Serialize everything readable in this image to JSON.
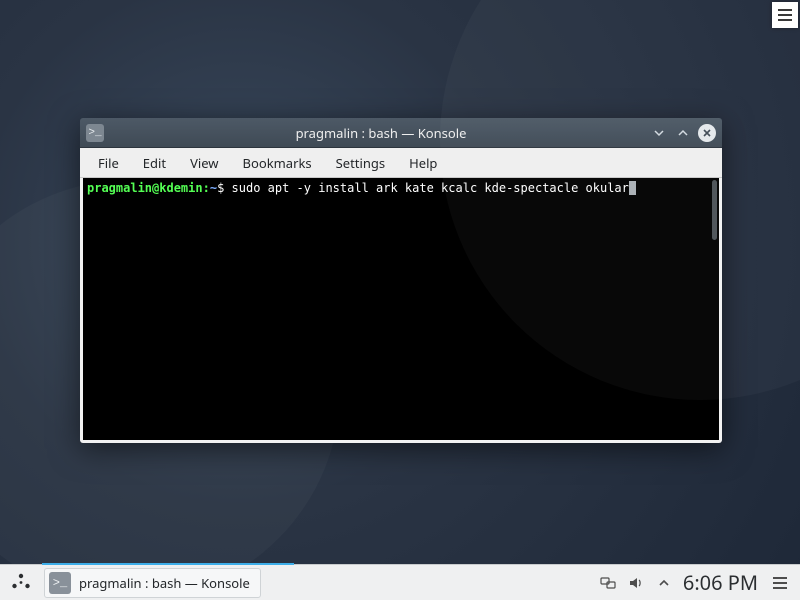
{
  "window": {
    "title": "pragmalin : bash — Konsole",
    "menubar": [
      "File",
      "Edit",
      "View",
      "Bookmarks",
      "Settings",
      "Help"
    ]
  },
  "terminal": {
    "prompt_userhost": "pragmalin@kdemin",
    "prompt_sep": ":",
    "prompt_path": "~",
    "prompt_symbol": "$",
    "command": "sudo apt -y install ark kate kcalc kde-spectacle okular"
  },
  "taskbar": {
    "active_task_label": "pragmalin : bash — Konsole",
    "clock": "6:06 PM"
  }
}
